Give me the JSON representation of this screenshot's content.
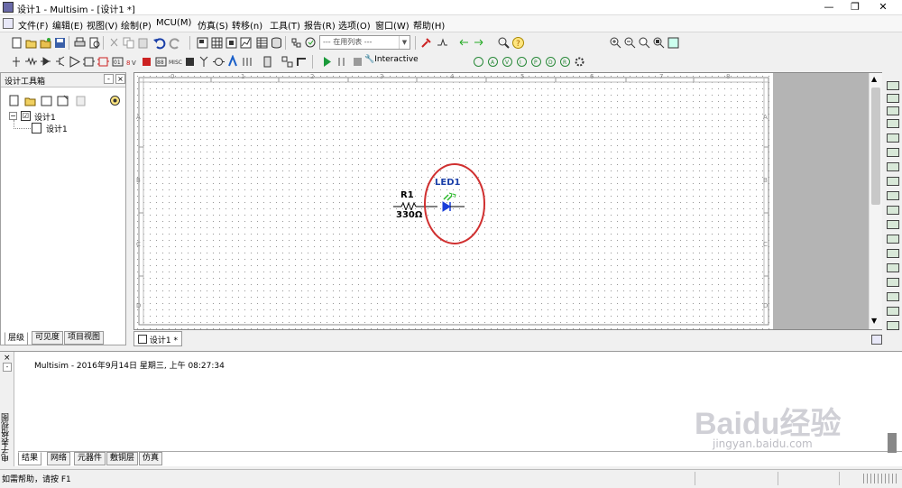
{
  "window": {
    "title": "设计1 - Multisim - [设计1 *]",
    "controls": [
      "—",
      "❐",
      "✕"
    ]
  },
  "menu": [
    "文件(F)",
    "编辑(E)",
    "视图(V)",
    "绘制(P)",
    "MCU(M)",
    "仿真(S)",
    "转移(n)",
    "工具(T)",
    "报告(R)",
    "选项(O)",
    "窗口(W)",
    "帮助(H)"
  ],
  "toolbar": {
    "in_use_list": "--- 在用列表 ---",
    "interactive_label": "Interactive"
  },
  "design_toolbox": {
    "title": "设计工具箱",
    "tree_root": "设计1",
    "tree_child": "设计1",
    "tabs": [
      "层级",
      "可见度",
      "项目视图"
    ]
  },
  "schematic": {
    "ruler_top": [
      "0",
      "1",
      "2",
      "3",
      "4",
      "5",
      "6",
      "7",
      "8"
    ],
    "ruler_side": [
      "A",
      "B",
      "C",
      "D"
    ],
    "resistor_ref": "R1",
    "resistor_value": "330Ω",
    "led_ref": "LED1",
    "doc_tab": "设计1 *"
  },
  "spreadsheet": {
    "side_label": "电子表格视图",
    "log_line": "Multisim  -  2016年9月14日 星期三, 上午 08:27:34",
    "tabs": [
      "结果",
      "网络",
      "元器件",
      "敷铜层",
      "仿真"
    ]
  },
  "status": {
    "help_text": "如需帮助，请按 F1"
  },
  "watermark": {
    "brand": "Baidu经验",
    "url": "jingyan.baidu.com"
  }
}
